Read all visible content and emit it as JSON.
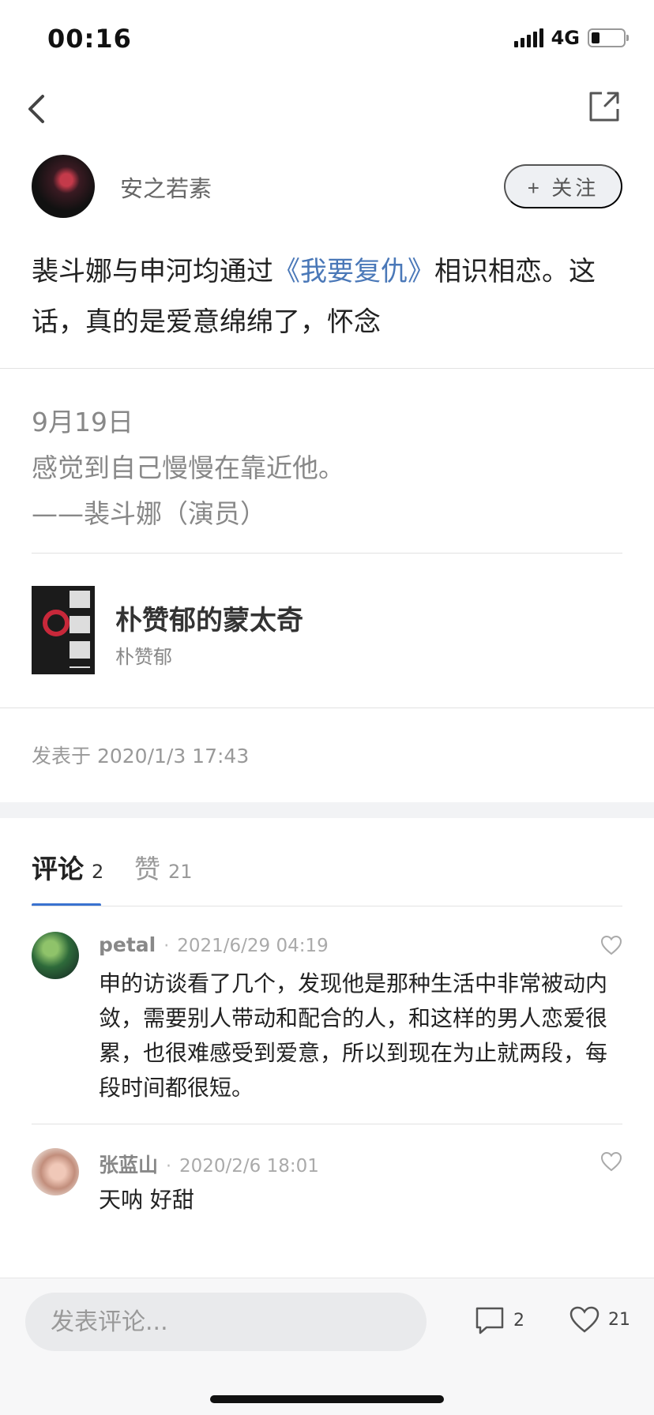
{
  "status_bar": {
    "time": "00:16",
    "network": "4G",
    "icons": [
      "signal-icon",
      "battery-icon"
    ]
  },
  "nav": {
    "icons": [
      "back-icon",
      "share-icon"
    ]
  },
  "author": {
    "name": "安之若素",
    "follow_label": "+ 关注"
  },
  "post": {
    "text_before": "裴斗娜与申河均通过",
    "link_text": "《我要复仇》",
    "text_after": "相识相恋。这话，真的是爱意绵绵了，怀念"
  },
  "quote": {
    "date": "9月19日",
    "line": "感觉到自己慢慢在靠近他。",
    "attribution": "——裴斗娜（演员）"
  },
  "book": {
    "title": "朴赞郁的蒙太奇",
    "author": "朴赞郁"
  },
  "post_time": "发表于 2020/1/3 17:43",
  "tabs": {
    "comments": {
      "label": "评论",
      "count": "2"
    },
    "likes": {
      "label": "赞",
      "count": "21"
    }
  },
  "comments": [
    {
      "user": "petal",
      "separator": "·",
      "date": "2021/6/29 04:19",
      "text": "申的访谈看了几个，发现他是那种生活中非常被动内敛，需要别人带动和配合的人，和这样的男人恋爱很累，也很难感受到爱意，所以到现在为止就两段，每段时间都很短。"
    },
    {
      "user": "张蓝山",
      "separator": "·",
      "date": "2020/2/6 18:01",
      "text": "天呐 好甜"
    }
  ],
  "bottom_bar": {
    "input_placeholder": "发表评论...",
    "comment_count": "2",
    "like_count": "21"
  },
  "colors": {
    "link": "#4a78b8",
    "tab_indicator": "#3a72d0"
  }
}
